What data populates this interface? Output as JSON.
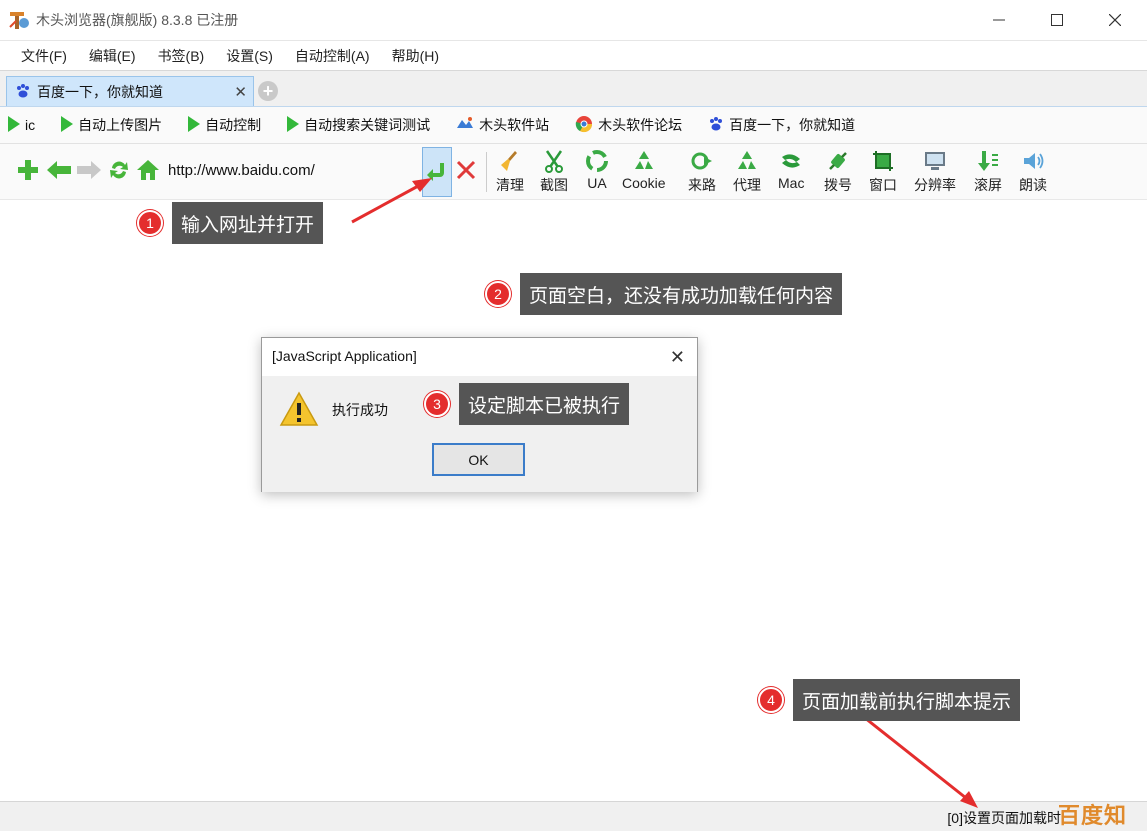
{
  "window": {
    "title": "木头浏览器(旗舰版) 8.3.8  已注册",
    "minimize": "—",
    "maximize": "☐",
    "close": "✕"
  },
  "menu": [
    "文件(F)",
    "编辑(E)",
    "书签(B)",
    "设置(S)",
    "自动控制(A)",
    "帮助(H)"
  ],
  "tab": {
    "label": "百度一下，你就知道",
    "close": "✕",
    "add": "+"
  },
  "bookmarks": [
    {
      "label": "ic",
      "icon": "play-icon"
    },
    {
      "label": "自动上传图片",
      "icon": "play-icon"
    },
    {
      "label": "自动控制",
      "icon": "play-icon"
    },
    {
      "label": "自动搜索关键词测试",
      "icon": "play-icon"
    },
    {
      "label": "木头软件站",
      "icon": "site-icon"
    },
    {
      "label": "木头软件论坛",
      "icon": "chrome-icon"
    },
    {
      "label": "百度一下，你就知道",
      "icon": "baidu-paw-icon"
    }
  ],
  "address": {
    "url": "http://www.baidu.com/"
  },
  "tools": [
    "清理",
    "截图",
    "UA",
    "Cookie",
    "来路",
    "代理",
    "Mac",
    "拨号",
    "窗口",
    "分辨率",
    "滚屏",
    "朗读"
  ],
  "dialog": {
    "title": "[JavaScript Application]",
    "message": "执行成功",
    "ok": "OK",
    "close": "✕"
  },
  "annotations": [
    {
      "num": "1",
      "text": "输入网址并打开"
    },
    {
      "num": "2",
      "text": "页面空白，还没有成功加载任何内容"
    },
    {
      "num": "3",
      "text": "设定脚本已被执行"
    },
    {
      "num": "4",
      "text": "页面加载前执行脚本提示"
    }
  ],
  "status": {
    "text": "[0]设置页面加载时"
  },
  "watermark": "百度知道",
  "colors": {
    "accent_green": "#33b83a",
    "annotation_red": "#e42d2d",
    "annotation_box": "#555555",
    "tab_active": "#cfe6fb"
  }
}
